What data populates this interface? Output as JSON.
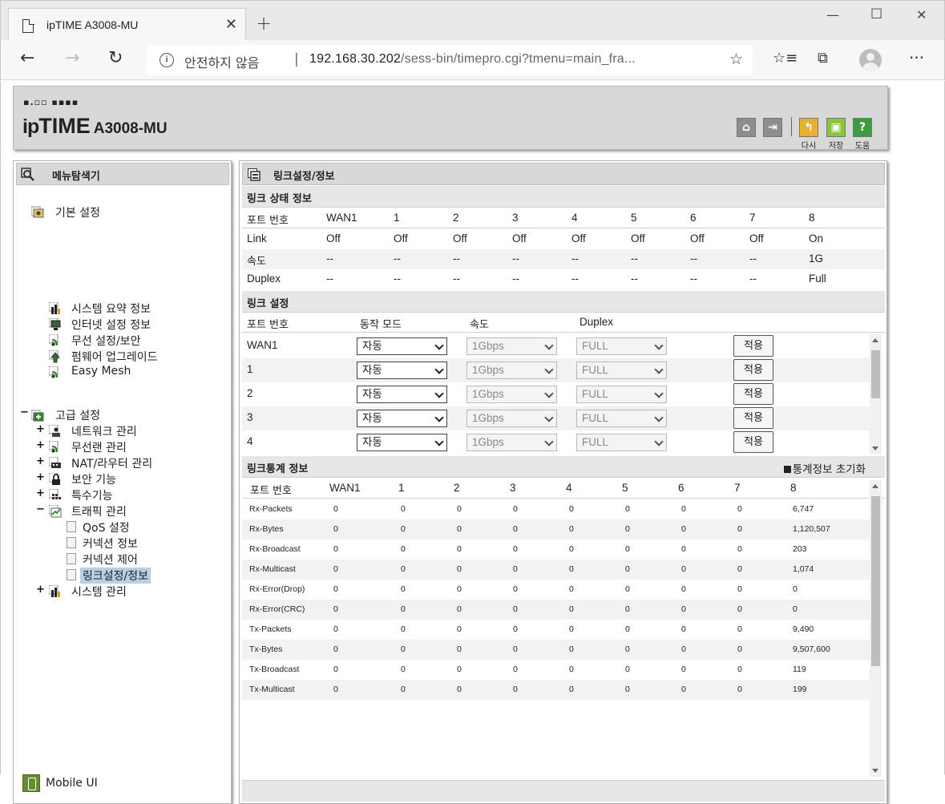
{
  "browser": {
    "tab_title": "ipTIME A3008-MU",
    "insecure_label": "안전하지 않음",
    "url_host": "192.168.30.202",
    "url_path": "/sess-bin/timepro.cgi?tmenu=main_fra..."
  },
  "header": {
    "logo_dots": "▪.▫▫ ▪▪▪▪",
    "logo_ip": "ip",
    "logo_time": "TIME",
    "model": "A3008-MU",
    "buttons": [
      {
        "label": "다시",
        "icon": "undo-icon"
      },
      {
        "label": "저장",
        "icon": "save-icon"
      },
      {
        "label": "도움",
        "icon": "help-icon"
      }
    ]
  },
  "sidebar": {
    "title": "메뉴탐색기",
    "basic": {
      "label": "기본 설정",
      "items": [
        "시스템 요약 정보",
        "인터넷 설정 정보",
        "무선 설정/보안",
        "펌웨어 업그레이드",
        "Easy Mesh"
      ]
    },
    "advanced": {
      "label": "고급 설정",
      "items": [
        "네트워크 관리",
        "무선랜 관리",
        "NAT/라우터 관리",
        "보안 기능",
        "특수기능",
        "트래픽 관리",
        "시스템 관리"
      ],
      "traffic_children": [
        "QoS 설정",
        "커넥션 정보",
        "커넥션 제어",
        "링크설정/정보"
      ]
    },
    "mobile_ui": "Mobile UI"
  },
  "main": {
    "title": "링크설정/정보",
    "status": {
      "title": "링크 상태 정보",
      "headers": [
        "포트 번호",
        "WAN1",
        "1",
        "2",
        "3",
        "4",
        "5",
        "6",
        "7",
        "8"
      ],
      "rows": [
        {
          "label": "Link",
          "values": [
            "Off",
            "Off",
            "Off",
            "Off",
            "Off",
            "Off",
            "Off",
            "Off",
            "On"
          ]
        },
        {
          "label": "속도",
          "values": [
            "--",
            "--",
            "--",
            "--",
            "--",
            "--",
            "--",
            "--",
            "1G"
          ]
        },
        {
          "label": "Duplex",
          "values": [
            "--",
            "--",
            "--",
            "--",
            "--",
            "--",
            "--",
            "--",
            "Full"
          ]
        }
      ]
    },
    "settings": {
      "title": "링크 설정",
      "headers": [
        "포트 번호",
        "동작 모드",
        "속도",
        "Duplex"
      ],
      "rows": [
        {
          "port": "WAN1",
          "mode": "자동",
          "speed": "1Gbps",
          "duplex": "FULL",
          "apply": "적용"
        },
        {
          "port": "1",
          "mode": "자동",
          "speed": "1Gbps",
          "duplex": "FULL",
          "apply": "적용"
        },
        {
          "port": "2",
          "mode": "자동",
          "speed": "1Gbps",
          "duplex": "FULL",
          "apply": "적용"
        },
        {
          "port": "3",
          "mode": "자동",
          "speed": "1Gbps",
          "duplex": "FULL",
          "apply": "적용"
        },
        {
          "port": "4",
          "mode": "자동",
          "speed": "1Gbps",
          "duplex": "FULL",
          "apply": "적용"
        }
      ]
    },
    "stats": {
      "title": "링크통계 정보",
      "reset_label": "통계정보 초기화",
      "headers": [
        "포트 번호",
        "WAN1",
        "1",
        "2",
        "3",
        "4",
        "5",
        "6",
        "7",
        "8"
      ],
      "rows": [
        {
          "label": "Rx-Packets",
          "values": [
            "0",
            "0",
            "0",
            "0",
            "0",
            "0",
            "0",
            "0",
            "6,747"
          ]
        },
        {
          "label": "Rx-Bytes",
          "values": [
            "0",
            "0",
            "0",
            "0",
            "0",
            "0",
            "0",
            "0",
            "1,120,507"
          ]
        },
        {
          "label": "Rx-Broadcast",
          "values": [
            "0",
            "0",
            "0",
            "0",
            "0",
            "0",
            "0",
            "0",
            "203"
          ]
        },
        {
          "label": "Rx-Multicast",
          "values": [
            "0",
            "0",
            "0",
            "0",
            "0",
            "0",
            "0",
            "0",
            "1,074"
          ]
        },
        {
          "label": "Rx-Error(Drop)",
          "values": [
            "0",
            "0",
            "0",
            "0",
            "0",
            "0",
            "0",
            "0",
            "0"
          ]
        },
        {
          "label": "Rx-Error(CRC)",
          "values": [
            "0",
            "0",
            "0",
            "0",
            "0",
            "0",
            "0",
            "0",
            "0"
          ]
        },
        {
          "label": "Tx-Packets",
          "values": [
            "0",
            "0",
            "0",
            "0",
            "0",
            "0",
            "0",
            "0",
            "9,490"
          ]
        },
        {
          "label": "Tx-Bytes",
          "values": [
            "0",
            "0",
            "0",
            "0",
            "0",
            "0",
            "0",
            "0",
            "9,507,600"
          ]
        },
        {
          "label": "Tx-Broadcast",
          "values": [
            "0",
            "0",
            "0",
            "0",
            "0",
            "0",
            "0",
            "0",
            "119"
          ]
        },
        {
          "label": "Tx-Multicast",
          "values": [
            "0",
            "0",
            "0",
            "0",
            "0",
            "0",
            "0",
            "0",
            "199"
          ]
        }
      ]
    }
  }
}
